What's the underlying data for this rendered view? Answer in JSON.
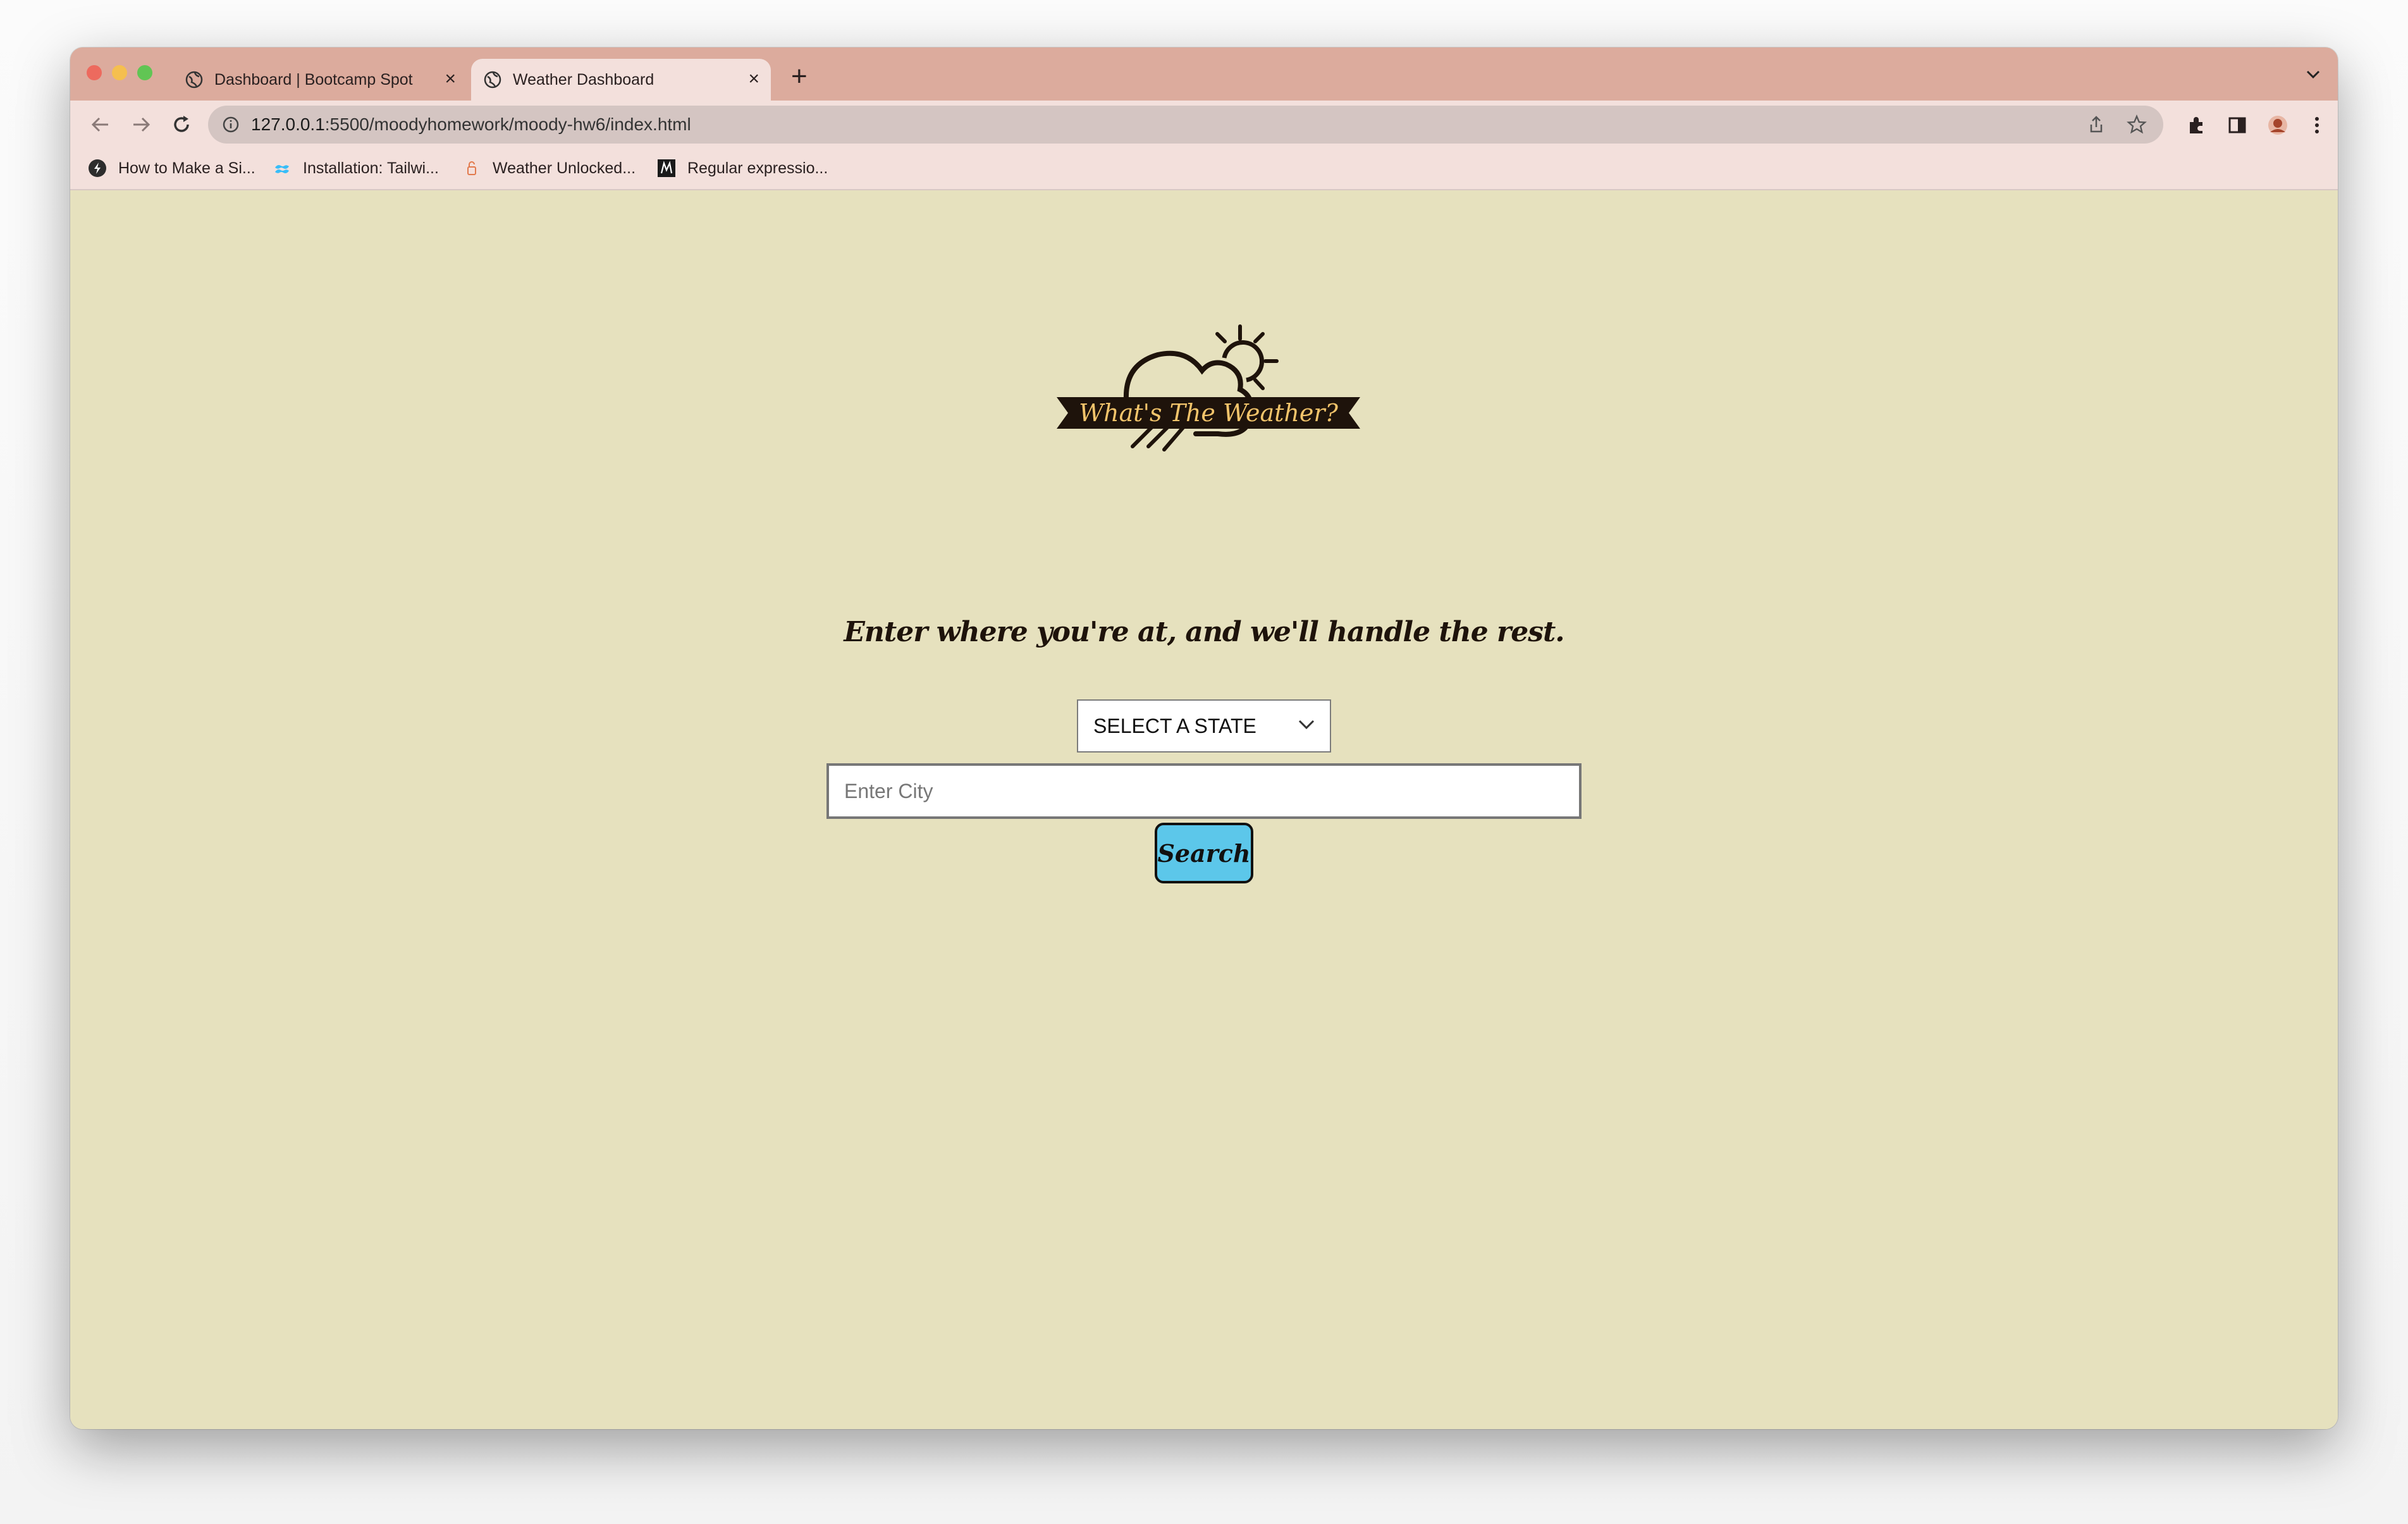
{
  "browser": {
    "tabs": [
      {
        "title": "Dashboard | Bootcamp Spot",
        "active": false
      },
      {
        "title": "Weather Dashboard",
        "active": true
      }
    ],
    "url_host": "127.0.0.1",
    "url_rest": ":5500/moodyhomework/moody-hw6/index.html",
    "bookmarks": [
      {
        "label": "How to Make a Si...",
        "icon": "dark-circle-icon"
      },
      {
        "label": "Installation: Tailwi...",
        "icon": "tailwind-icon"
      },
      {
        "label": "Weather Unlocked...",
        "icon": "weather-unlocked-icon"
      },
      {
        "label": "Regular expressio...",
        "icon": "m-icon"
      }
    ]
  },
  "page": {
    "logo_text": "What's The Weather?",
    "tagline": "Enter where you're at, and we'll handle the rest.",
    "state_select": {
      "value": "SELECT A STATE"
    },
    "city_input": {
      "placeholder": "Enter City",
      "value": ""
    },
    "search_label": "Search"
  },
  "colors": {
    "tabstrip": "#dcab9d",
    "toolbar": "#f3e0dc",
    "page_bg": "#e6e1be",
    "search_button": "#5cc7ea",
    "logo_text": "#f2c46b",
    "logo_dark": "#1e130b"
  }
}
